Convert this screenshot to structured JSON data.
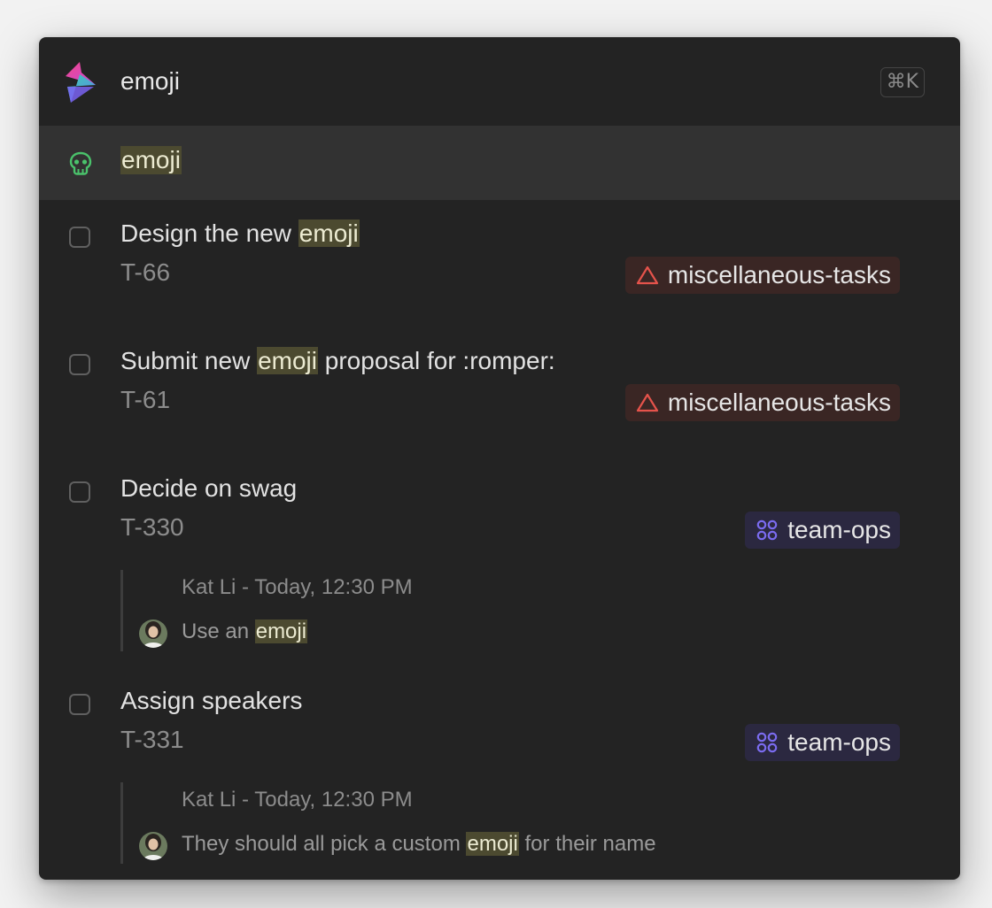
{
  "search": {
    "value": "emoji",
    "shortcut": "⌘K"
  },
  "suggestion": {
    "label": "emoji",
    "icon": "emoji-icon"
  },
  "results": [
    {
      "title_before": "Design the new ",
      "title_match": "emoji",
      "title_after": "",
      "id": "T-66",
      "tag": {
        "label": "miscellaneous-tasks",
        "icon": "triangle-icon",
        "color": "#e5534b"
      }
    },
    {
      "title_before": "Submit new ",
      "title_match": "emoji",
      "title_after": " proposal for :romper:",
      "id": "T-61",
      "tag": {
        "label": "miscellaneous-tasks",
        "icon": "triangle-icon",
        "color": "#e5534b"
      }
    },
    {
      "title": "Decide on swag",
      "id": "T-330",
      "tag": {
        "label": "team-ops",
        "icon": "grid-circles-icon",
        "color": "#7b6cf0"
      },
      "comment": {
        "meta": "Kat Li - Today, 12:30 PM",
        "body_before": "Use an ",
        "body_match": "emoji",
        "body_after": ""
      }
    },
    {
      "title": "Assign speakers",
      "id": "T-331",
      "tag": {
        "label": "team-ops",
        "icon": "grid-circles-icon",
        "color": "#7b6cf0"
      },
      "comment": {
        "meta": "Kat Li - Today, 12:30 PM",
        "body_before": "They should all pick a custom ",
        "body_match": "emoji",
        "body_after": " for their name"
      }
    }
  ],
  "colors": {
    "panel": "#232323",
    "selected_row": "#323232",
    "highlight": "#4c4a30"
  }
}
